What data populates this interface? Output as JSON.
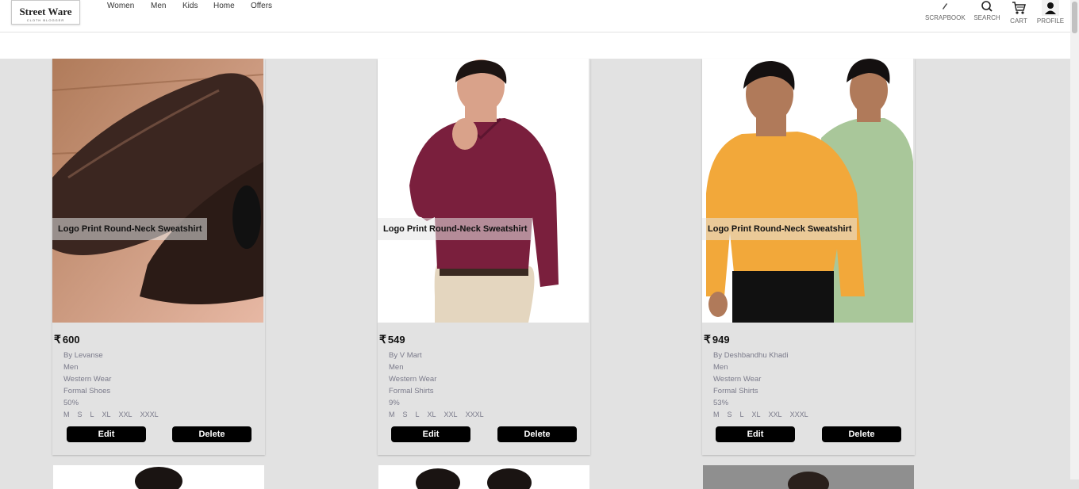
{
  "header": {
    "logo": {
      "title": "Street Ware",
      "subtitle": "CLOTH BLOGGER"
    },
    "nav": [
      "Women",
      "Men",
      "Kids",
      "Home",
      "Offers"
    ],
    "actions": [
      {
        "label": "SCRAPBOOK",
        "icon": "pencil-icon"
      },
      {
        "label": "SEARCH",
        "icon": "search-icon"
      },
      {
        "label": "CART",
        "icon": "cart-icon"
      },
      {
        "label": "PROFILE",
        "icon": "user-icon"
      }
    ]
  },
  "currency_symbol": "₹",
  "products": [
    {
      "title": "Logo Print Round-Neck Sweatshirt",
      "price": "600",
      "brand": "By Levanse",
      "gender": "Men",
      "category": "Western Wear",
      "subcategory": "Formal Shoes",
      "discount": "50%",
      "sizes": [
        "M",
        "S",
        "L",
        "XL",
        "XXL",
        "XXXL"
      ],
      "edit_label": "Edit",
      "delete_label": "Delete"
    },
    {
      "title": "Logo Print Round-Neck Sweatshirt",
      "price": "549",
      "brand": "By V Mart",
      "gender": "Men",
      "category": "Western Wear",
      "subcategory": "Formal Shirts",
      "discount": "9%",
      "sizes": [
        "M",
        "S",
        "L",
        "XL",
        "XXL",
        "XXXL"
      ],
      "edit_label": "Edit",
      "delete_label": "Delete"
    },
    {
      "title": "Logo Print Round-Neck Sweatshirt",
      "price": "949",
      "brand": "By Deshbandhu Khadi",
      "gender": "Men",
      "category": "Western Wear",
      "subcategory": "Formal Shirts",
      "discount": "53%",
      "sizes": [
        "M",
        "S",
        "L",
        "XL",
        "XXL",
        "XXXL"
      ],
      "edit_label": "Edit",
      "delete_label": "Delete"
    }
  ]
}
